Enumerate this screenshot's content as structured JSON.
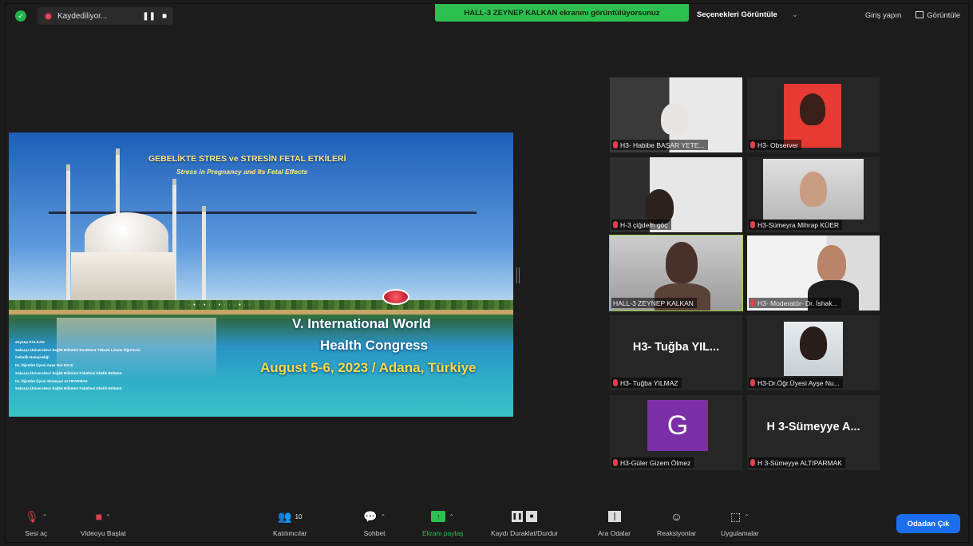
{
  "top_bar": {
    "recording_label": "Kaydediliyor...",
    "pause_symbol": "❚❚",
    "stop_symbol": "■",
    "share_banner": "HALL-3 ZEYNEP KALKAN ekranını görüntülüyorsunuz",
    "view_options": "Seçenekleri Görüntüle",
    "view_options_caret": "⌄",
    "exit_full": "Giriş yapın",
    "view_label": "Görüntüle"
  },
  "slide": {
    "title": "GEBELİKTE STRES ve STRESİN FETAL ETKİLERİ",
    "subtitle": "Stress in Pregnancy and Its Fetal Effects",
    "congress_line1": "V. International World",
    "congress_line2": "Health Congress",
    "congress_date": "August 5-6, 2023 / Adana, Türkiye",
    "authors": [
      "Zeynep KALKAN",
      "Sakarya Üniversitesi Sağlık Bilimleri Enstitüsü Yüksek Lisans Öğrencisi",
      "Gebelik Hemşireliği",
      "Dr. Öğretim Üyesi Ayşe Nur KILIÇ",
      "Sakarya Üniversitesi Sağlık Bilimleri Fakültesi Ebelik Bölümü",
      "Dr. Öğretim Üyesi Sümeyye ALTIPARMAK",
      "Sakarya Üniversitesi Sağlık Bilimleri Fakültesi Ebelik Bölümü"
    ],
    "dots_text": "· • · • · · • · · · • · ·"
  },
  "participants": [
    {
      "name": "H3- Habibe BAŞAR YETE...",
      "type": "video"
    },
    {
      "name": "H3- Observer",
      "type": "video"
    },
    {
      "name": "H-3 çiğdem göç",
      "type": "video"
    },
    {
      "name": "H3-Sümeyra Mihrap KÜER",
      "type": "video"
    },
    {
      "name": "HALL-3 ZEYNEP KALKAN",
      "type": "video",
      "active": true
    },
    {
      "name": "H3- Moderatör- Dr. İshak...",
      "type": "video"
    },
    {
      "name": "H3- Tuğba YILMAZ",
      "type": "name",
      "big": "H3- Tuğba YIL..."
    },
    {
      "name": "H3-Dr.Öğr.Üyesi Ayşe Nu...",
      "type": "video"
    },
    {
      "name": "H3-Güler Gizem Ölmez",
      "type": "avatar",
      "initial": "G"
    },
    {
      "name": "H 3-Sümeyye ALTIPARMAK",
      "type": "name",
      "big": "H 3-Sümeyye A..."
    }
  ],
  "toolbar": {
    "audio": "Sesi aç",
    "video": "Videoyu Başlat",
    "participants": "Katılımcılar",
    "participants_count": "10",
    "chat": "Sohbet",
    "share": "Ekranı paylaş",
    "record": "Kaydı Duraklat/Durdur",
    "breakout": "Ara Odalar",
    "reactions": "Reaksiyonlar",
    "apps": "Uygulamalar",
    "caret": "⌃",
    "leave": "Odadan Çık"
  },
  "colors": {
    "share_banner": "#2dbf4f",
    "leave_button": "#1b6ef0",
    "active_speaker": "#9fd04a",
    "avatar": "#7b2fa6",
    "recording": "#e04a5f"
  }
}
